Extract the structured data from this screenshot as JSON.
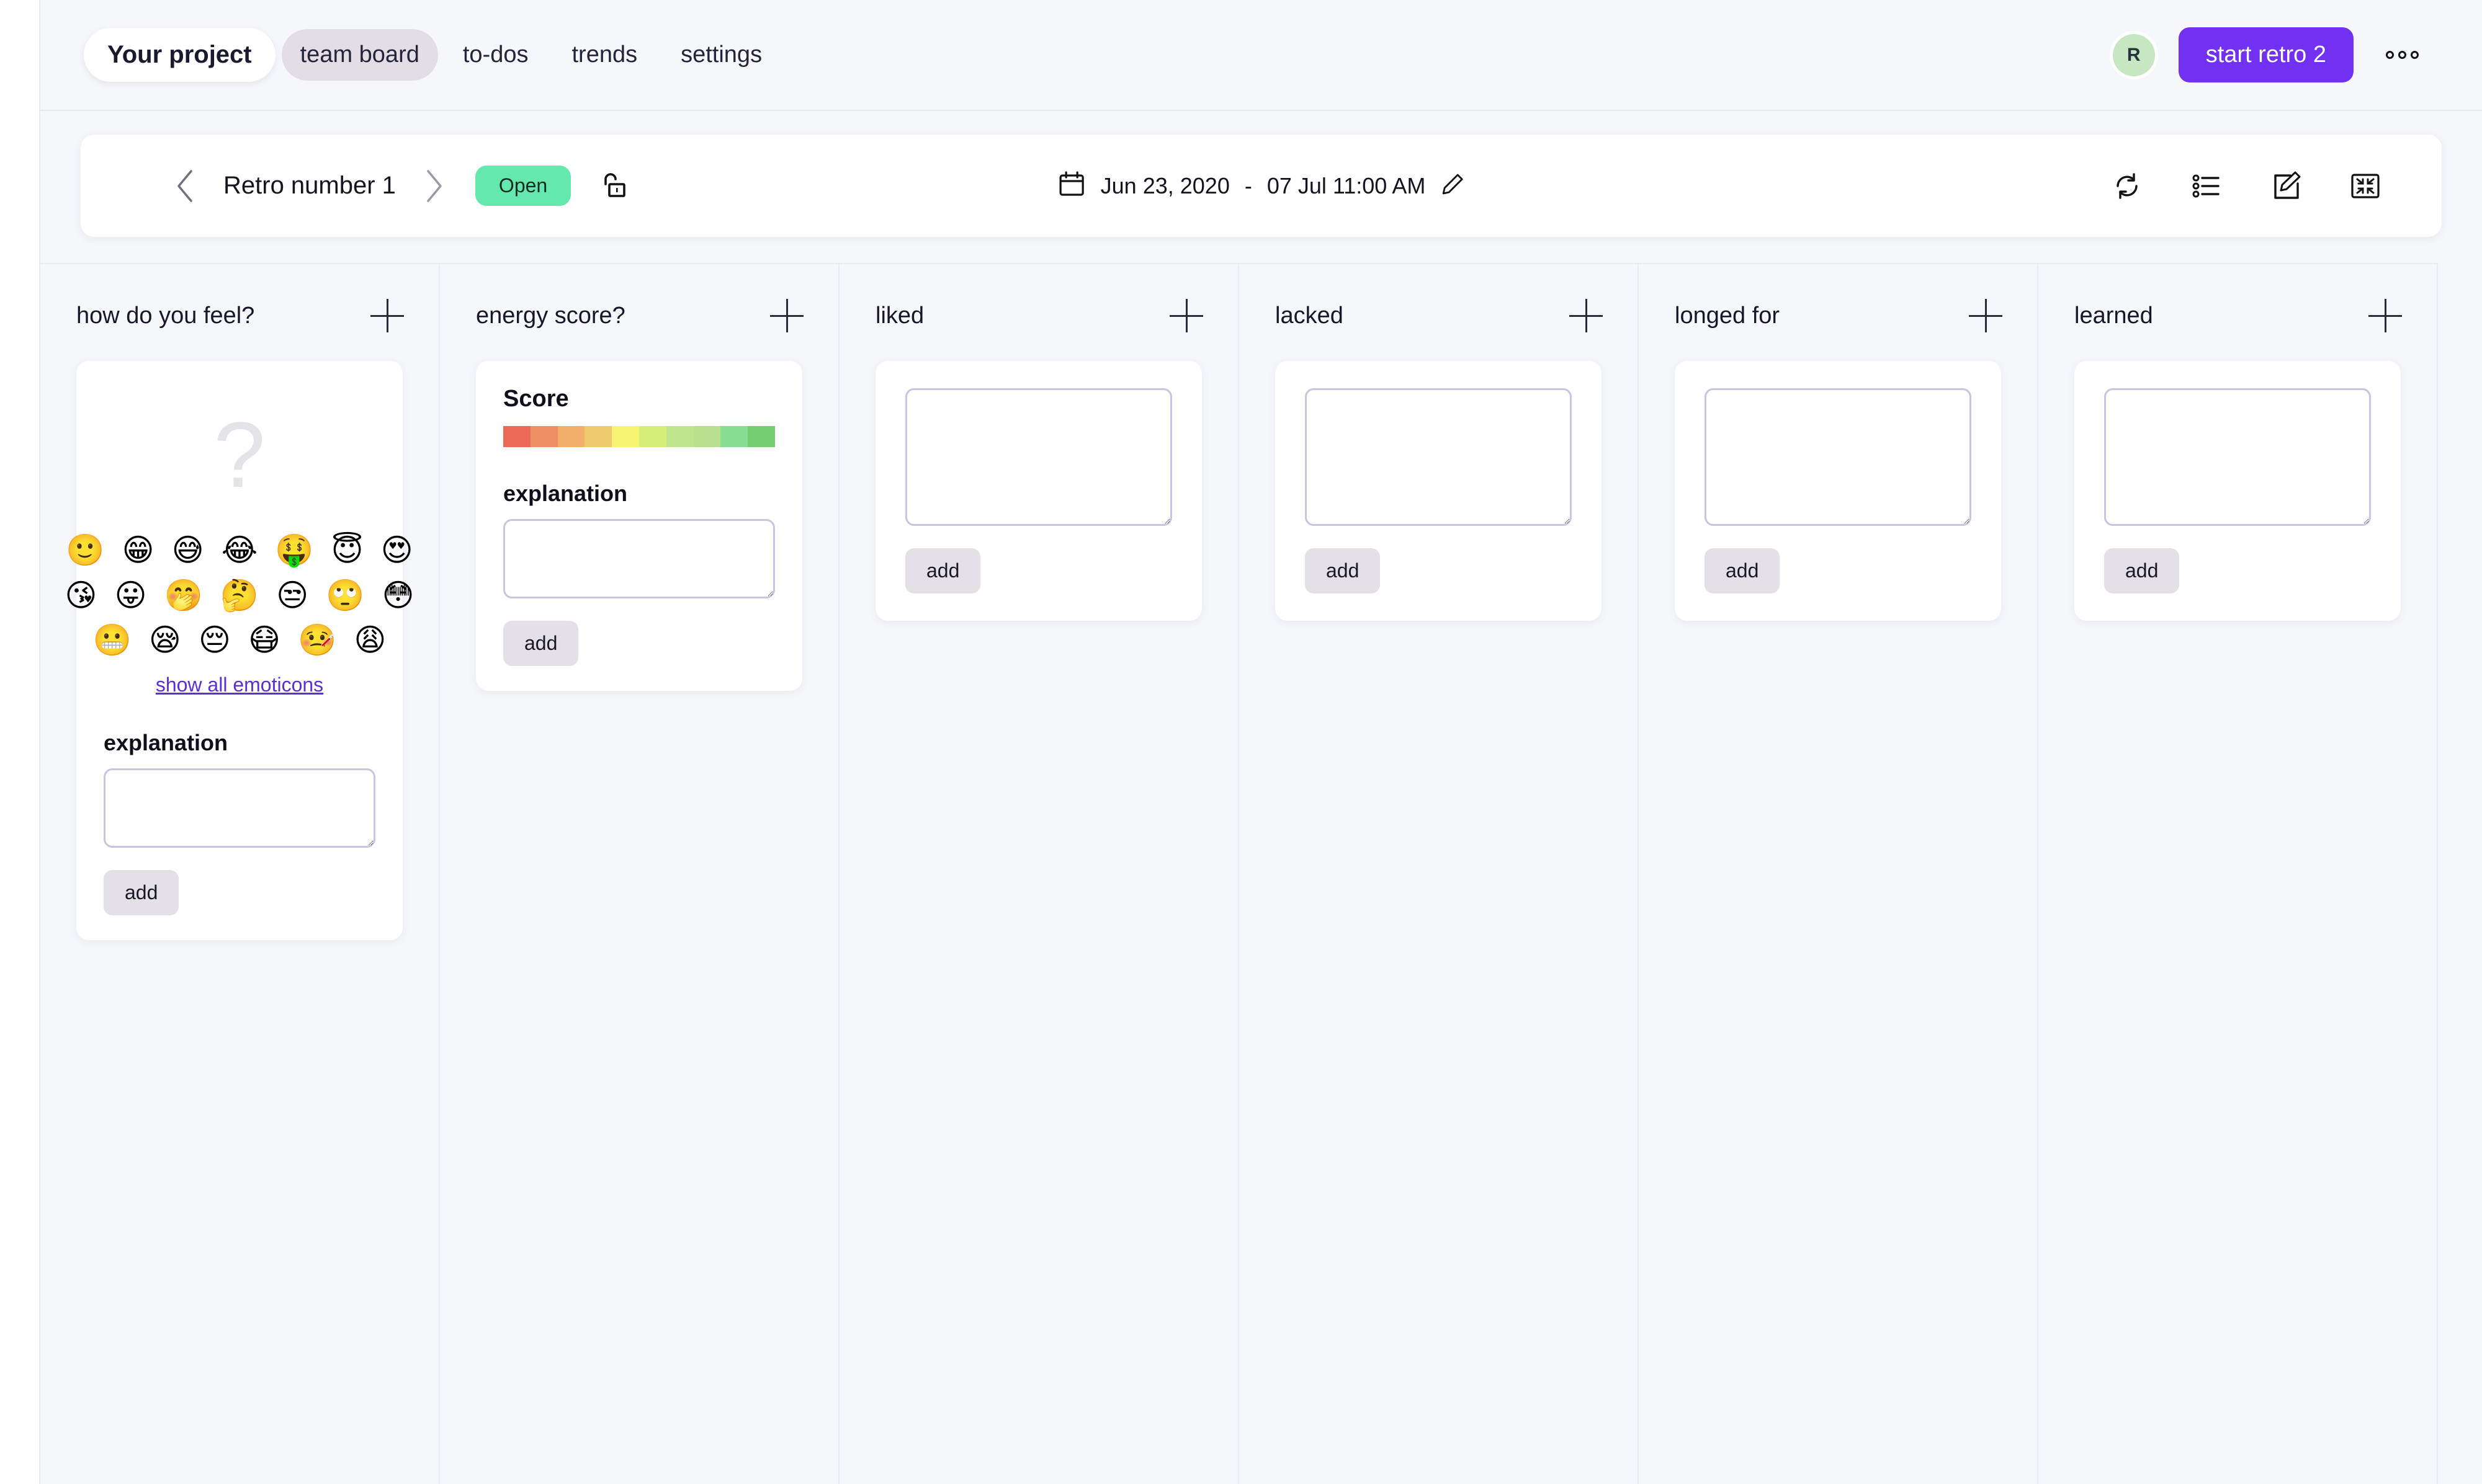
{
  "topnav": {
    "project_label": "Your project",
    "tabs": [
      {
        "label": "team board",
        "active": true
      },
      {
        "label": "to-dos",
        "active": false
      },
      {
        "label": "trends",
        "active": false
      },
      {
        "label": "settings",
        "active": false
      }
    ],
    "avatar_initial": "R",
    "primary_button": "start retro 2",
    "more_icon": "kebab-horizontal-icon"
  },
  "retro_bar": {
    "prev_icon": "chevron-left-icon",
    "next_icon": "chevron-right-icon",
    "title": "Retro number 1",
    "status_badge": "Open",
    "lock_icon": "unlock-icon",
    "calendar_icon": "calendar-icon",
    "date_start": "Jun 23, 2020",
    "date_separator": "-",
    "date_end": "07 Jul 11:00 AM",
    "edit_date_icon": "pencil-icon",
    "actions": [
      {
        "icon": "refresh-icon"
      },
      {
        "icon": "list-icon"
      },
      {
        "icon": "edit-square-icon"
      },
      {
        "icon": "collapse-icon"
      }
    ]
  },
  "board": {
    "add_column_icon": "plus-icon",
    "columns": [
      {
        "title": "how do you feel?",
        "type": "feel"
      },
      {
        "title": "energy score?",
        "type": "score"
      },
      {
        "title": "liked",
        "type": "plain"
      },
      {
        "title": "lacked",
        "type": "plain"
      },
      {
        "title": "longed for",
        "type": "plain"
      },
      {
        "title": "learned",
        "type": "plain"
      }
    ]
  },
  "feel_card": {
    "placeholder_glyph": "?",
    "emoji_rows": [
      [
        {
          "glyph": "🙂",
          "name": "slightly-smiling-face"
        },
        {
          "glyph": "😁",
          "name": "beaming-face"
        },
        {
          "glyph": "😅",
          "name": "grinning-face-with-sweat"
        },
        {
          "glyph": "😂",
          "name": "face-with-tears-of-joy"
        },
        {
          "glyph": "🤑",
          "name": "money-mouth-face"
        },
        {
          "glyph": "😇",
          "name": "smiling-face-with-halo"
        },
        {
          "glyph": "😍",
          "name": "smiling-face-with-heart-eyes"
        }
      ],
      [
        {
          "glyph": "😘",
          "name": "face-blowing-a-kiss"
        },
        {
          "glyph": "😛",
          "name": "face-with-tongue"
        },
        {
          "glyph": "🤭",
          "name": "face-with-hand-over-mouth"
        },
        {
          "glyph": "🤔",
          "name": "thinking-face"
        },
        {
          "glyph": "😒",
          "name": "unamused-face"
        },
        {
          "glyph": "🙄",
          "name": "face-with-rolling-eyes"
        },
        {
          "glyph": "😳",
          "name": "flushed-face"
        }
      ],
      [
        {
          "glyph": "😬",
          "name": "grimacing-face"
        },
        {
          "glyph": "😪",
          "name": "sleepy-face"
        },
        {
          "glyph": "😔",
          "name": "pensive-face"
        },
        {
          "glyph": "😷",
          "name": "face-with-medical-mask"
        },
        {
          "glyph": "🤒",
          "name": "face-with-thermometer"
        },
        {
          "glyph": "😩",
          "name": "weary-face"
        }
      ]
    ],
    "show_all_link": "show all emoticons",
    "explanation_label": "explanation",
    "explanation_value": "",
    "add_label": "add"
  },
  "score_card": {
    "score_label": "Score",
    "scale_colors": [
      "#ea6a57",
      "#ec9166",
      "#f2ae6b",
      "#eecb6e",
      "#f7f473",
      "#d6ef7a",
      "#bfe58c",
      "#b8e18d",
      "#88dd92",
      "#77cd72"
    ],
    "explanation_label": "explanation",
    "explanation_value": "",
    "add_label": "add"
  },
  "plain_card": {
    "text_value": "",
    "add_label": "add"
  },
  "colors": {
    "accent": "#7230f0",
    "badge": "#64e8ae",
    "page_bg": "#f6f7fb",
    "card_bg": "#ffffff",
    "border": "#e9ecf2",
    "link": "#5b2fd4",
    "avatar_bg": "#c7e6c2",
    "button_bg": "#e4e0e8",
    "input_border": "#cac4e0"
  }
}
